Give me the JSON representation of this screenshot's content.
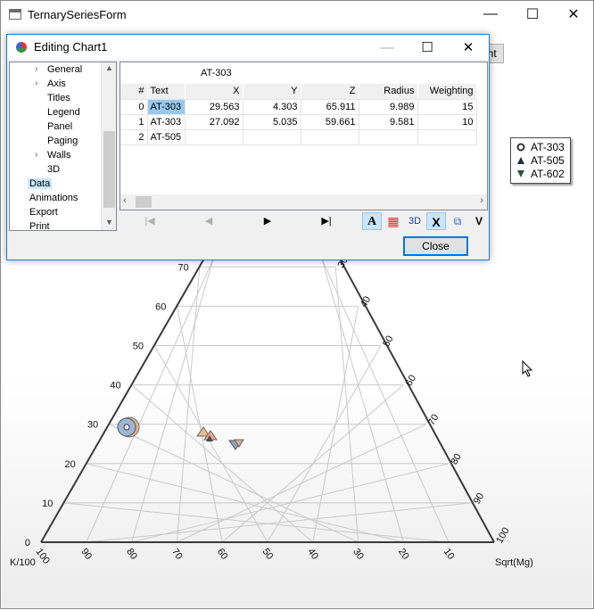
{
  "window": {
    "title": "TernarySeriesForm",
    "minimize_glyph": "—",
    "maximize_glyph": "☐",
    "close_glyph": "✕",
    "partial_button_label": "ght"
  },
  "legend": {
    "items": [
      {
        "label": "AT-303",
        "marker": "circle",
        "color": "#3b3b3b"
      },
      {
        "label": "AT-505",
        "marker": "triangle-up",
        "color": "#1f2d3d"
      },
      {
        "label": "AT-602",
        "marker": "triangle-down",
        "color": "#2f4f3f"
      }
    ]
  },
  "chart_data": {
    "type": "scatter",
    "subtype": "ternary",
    "axes": {
      "left": {
        "label": "K/100",
        "ticks": [
          "0",
          "10",
          "20",
          "30",
          "40",
          "50",
          "60",
          "70"
        ]
      },
      "bottom": {
        "ticks": [
          "100",
          "90",
          "80",
          "70",
          "60",
          "50",
          "40",
          "30",
          "20",
          "10"
        ]
      },
      "right": {
        "label": "Sqrt(Mg)",
        "ticks": [
          "30",
          "40",
          "50",
          "60",
          "70",
          "80",
          "90",
          "100"
        ]
      }
    },
    "series": [
      {
        "name": "AT-303",
        "marker": "circle",
        "points": [
          {
            "x": 29.563,
            "y": 4.303,
            "z": 65.911,
            "radius": 9.989,
            "weighting": 15
          },
          {
            "x": 27.092,
            "y": 5.035,
            "z": 59.661,
            "radius": 9.581,
            "weighting": 10
          }
        ]
      },
      {
        "name": "AT-505",
        "marker": "triangle-up",
        "points": []
      },
      {
        "name": "AT-602",
        "marker": "triangle-down",
        "points": []
      }
    ],
    "grid": true
  },
  "dialog": {
    "title": "Editing Chart1",
    "tree": {
      "items": [
        {
          "label": "General",
          "expandable": false
        },
        {
          "label": "Axis",
          "expandable": true
        },
        {
          "label": "Titles",
          "expandable": true
        },
        {
          "label": "Legend",
          "expandable": false
        },
        {
          "label": "Panel",
          "expandable": false
        },
        {
          "label": "Paging",
          "expandable": false
        },
        {
          "label": "Walls",
          "expandable": true
        },
        {
          "label": "3D",
          "expandable": false
        },
        {
          "label": "Data",
          "expandable": false,
          "selected": true
        },
        {
          "label": "Animations",
          "expandable": false
        },
        {
          "label": "Export",
          "expandable": false
        },
        {
          "label": "Print",
          "expandable": false
        }
      ]
    },
    "grid": {
      "caption": "AT-303",
      "columns": [
        "#",
        "Text",
        "X",
        "Y",
        "Z",
        "Radius",
        "Weighting"
      ],
      "rows": [
        {
          "index": "0",
          "text": "AT-303",
          "x": "29.563",
          "y": "4.303",
          "z": "65.911",
          "radius": "9.989",
          "weighting": "15"
        },
        {
          "index": "1",
          "text": "AT-303",
          "x": "27.092",
          "y": "5.035",
          "z": "59.661",
          "radius": "9.581",
          "weighting": "10"
        },
        {
          "index": "2",
          "text": "AT-505",
          "x": "",
          "y": "",
          "z": "",
          "radius": "",
          "weighting": ""
        }
      ]
    },
    "nav": {
      "first": "|◀",
      "prev": "◀",
      "next": "▶",
      "last": "▶|"
    },
    "tools": {
      "font": "A",
      "colors": "▦",
      "three_d": "3D",
      "delete": "X",
      "copy": "⧉",
      "more": "V"
    },
    "close_label": "Close"
  }
}
